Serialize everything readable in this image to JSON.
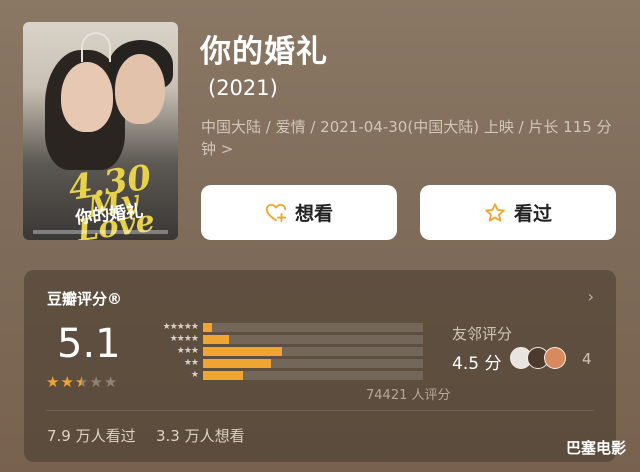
{
  "movie": {
    "title": "你的婚礼",
    "year": "(2021)",
    "meta": "中国大陆 / 爱情 / 2021-04-30(中国大陆) 上映 / 片长 115 分钟 >",
    "poster_text": {
      "yellow_line1": "4.30",
      "yellow_line2": "My Love",
      "chinese": "你的婚礼"
    }
  },
  "actions": {
    "want_label": "想看",
    "seen_label": "看过"
  },
  "rating": {
    "title": "豆瓣评分®",
    "score": "5.1",
    "stars_value": 2.5,
    "stars_total": 5,
    "distribution": [
      {
        "stars": "★★★★★",
        "fraction": 0.04
      },
      {
        "stars": "★★★★",
        "fraction": 0.12
      },
      {
        "stars": "★★★",
        "fraction": 0.36
      },
      {
        "stars": "★★",
        "fraction": 0.31
      },
      {
        "stars": "★",
        "fraction": 0.18
      }
    ],
    "votes": "74421 人评分",
    "neighbor_label": "友邻评分",
    "neighbor_score": "4.5 分",
    "neighbor_count": "4",
    "watched": "7.9 万人看过",
    "want": "3.3 万人想看"
  },
  "watermark": "巴塞电影",
  "colors": {
    "accent": "#f0a531",
    "background": "#7d6a58",
    "button": "#ffffff"
  }
}
